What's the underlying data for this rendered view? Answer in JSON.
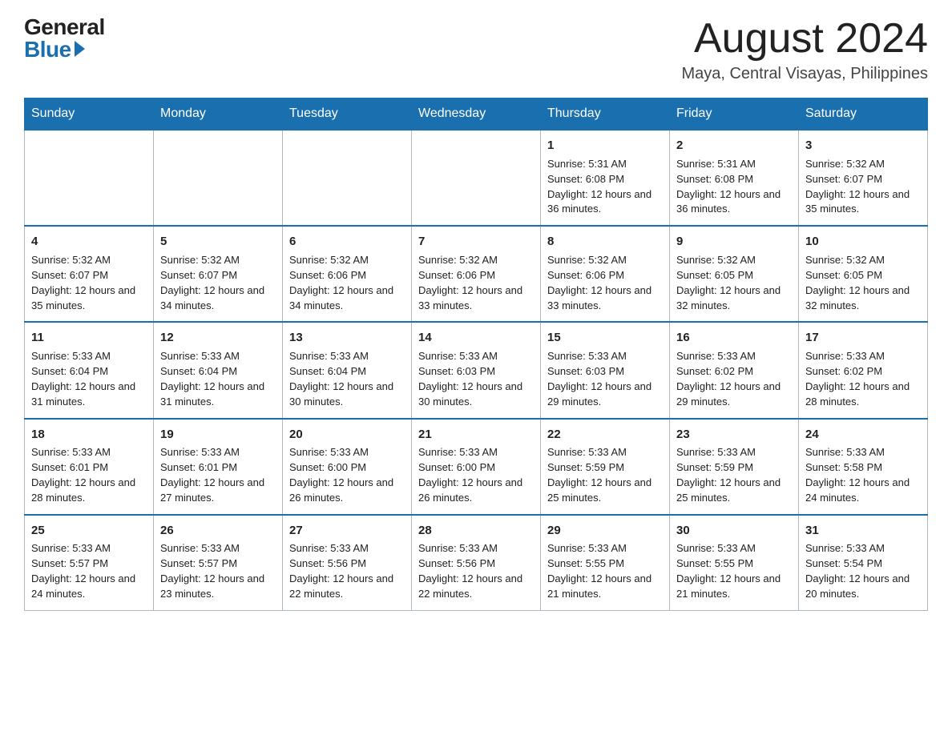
{
  "logo": {
    "general": "General",
    "blue": "Blue"
  },
  "header": {
    "month": "August 2024",
    "location": "Maya, Central Visayas, Philippines"
  },
  "weekdays": [
    "Sunday",
    "Monday",
    "Tuesday",
    "Wednesday",
    "Thursday",
    "Friday",
    "Saturday"
  ],
  "weeks": [
    [
      {
        "day": "",
        "info": ""
      },
      {
        "day": "",
        "info": ""
      },
      {
        "day": "",
        "info": ""
      },
      {
        "day": "",
        "info": ""
      },
      {
        "day": "1",
        "info": "Sunrise: 5:31 AM\nSunset: 6:08 PM\nDaylight: 12 hours and 36 minutes."
      },
      {
        "day": "2",
        "info": "Sunrise: 5:31 AM\nSunset: 6:08 PM\nDaylight: 12 hours and 36 minutes."
      },
      {
        "day": "3",
        "info": "Sunrise: 5:32 AM\nSunset: 6:07 PM\nDaylight: 12 hours and 35 minutes."
      }
    ],
    [
      {
        "day": "4",
        "info": "Sunrise: 5:32 AM\nSunset: 6:07 PM\nDaylight: 12 hours and 35 minutes."
      },
      {
        "day": "5",
        "info": "Sunrise: 5:32 AM\nSunset: 6:07 PM\nDaylight: 12 hours and 34 minutes."
      },
      {
        "day": "6",
        "info": "Sunrise: 5:32 AM\nSunset: 6:06 PM\nDaylight: 12 hours and 34 minutes."
      },
      {
        "day": "7",
        "info": "Sunrise: 5:32 AM\nSunset: 6:06 PM\nDaylight: 12 hours and 33 minutes."
      },
      {
        "day": "8",
        "info": "Sunrise: 5:32 AM\nSunset: 6:06 PM\nDaylight: 12 hours and 33 minutes."
      },
      {
        "day": "9",
        "info": "Sunrise: 5:32 AM\nSunset: 6:05 PM\nDaylight: 12 hours and 32 minutes."
      },
      {
        "day": "10",
        "info": "Sunrise: 5:32 AM\nSunset: 6:05 PM\nDaylight: 12 hours and 32 minutes."
      }
    ],
    [
      {
        "day": "11",
        "info": "Sunrise: 5:33 AM\nSunset: 6:04 PM\nDaylight: 12 hours and 31 minutes."
      },
      {
        "day": "12",
        "info": "Sunrise: 5:33 AM\nSunset: 6:04 PM\nDaylight: 12 hours and 31 minutes."
      },
      {
        "day": "13",
        "info": "Sunrise: 5:33 AM\nSunset: 6:04 PM\nDaylight: 12 hours and 30 minutes."
      },
      {
        "day": "14",
        "info": "Sunrise: 5:33 AM\nSunset: 6:03 PM\nDaylight: 12 hours and 30 minutes."
      },
      {
        "day": "15",
        "info": "Sunrise: 5:33 AM\nSunset: 6:03 PM\nDaylight: 12 hours and 29 minutes."
      },
      {
        "day": "16",
        "info": "Sunrise: 5:33 AM\nSunset: 6:02 PM\nDaylight: 12 hours and 29 minutes."
      },
      {
        "day": "17",
        "info": "Sunrise: 5:33 AM\nSunset: 6:02 PM\nDaylight: 12 hours and 28 minutes."
      }
    ],
    [
      {
        "day": "18",
        "info": "Sunrise: 5:33 AM\nSunset: 6:01 PM\nDaylight: 12 hours and 28 minutes."
      },
      {
        "day": "19",
        "info": "Sunrise: 5:33 AM\nSunset: 6:01 PM\nDaylight: 12 hours and 27 minutes."
      },
      {
        "day": "20",
        "info": "Sunrise: 5:33 AM\nSunset: 6:00 PM\nDaylight: 12 hours and 26 minutes."
      },
      {
        "day": "21",
        "info": "Sunrise: 5:33 AM\nSunset: 6:00 PM\nDaylight: 12 hours and 26 minutes."
      },
      {
        "day": "22",
        "info": "Sunrise: 5:33 AM\nSunset: 5:59 PM\nDaylight: 12 hours and 25 minutes."
      },
      {
        "day": "23",
        "info": "Sunrise: 5:33 AM\nSunset: 5:59 PM\nDaylight: 12 hours and 25 minutes."
      },
      {
        "day": "24",
        "info": "Sunrise: 5:33 AM\nSunset: 5:58 PM\nDaylight: 12 hours and 24 minutes."
      }
    ],
    [
      {
        "day": "25",
        "info": "Sunrise: 5:33 AM\nSunset: 5:57 PM\nDaylight: 12 hours and 24 minutes."
      },
      {
        "day": "26",
        "info": "Sunrise: 5:33 AM\nSunset: 5:57 PM\nDaylight: 12 hours and 23 minutes."
      },
      {
        "day": "27",
        "info": "Sunrise: 5:33 AM\nSunset: 5:56 PM\nDaylight: 12 hours and 22 minutes."
      },
      {
        "day": "28",
        "info": "Sunrise: 5:33 AM\nSunset: 5:56 PM\nDaylight: 12 hours and 22 minutes."
      },
      {
        "day": "29",
        "info": "Sunrise: 5:33 AM\nSunset: 5:55 PM\nDaylight: 12 hours and 21 minutes."
      },
      {
        "day": "30",
        "info": "Sunrise: 5:33 AM\nSunset: 5:55 PM\nDaylight: 12 hours and 21 minutes."
      },
      {
        "day": "31",
        "info": "Sunrise: 5:33 AM\nSunset: 5:54 PM\nDaylight: 12 hours and 20 minutes."
      }
    ]
  ]
}
